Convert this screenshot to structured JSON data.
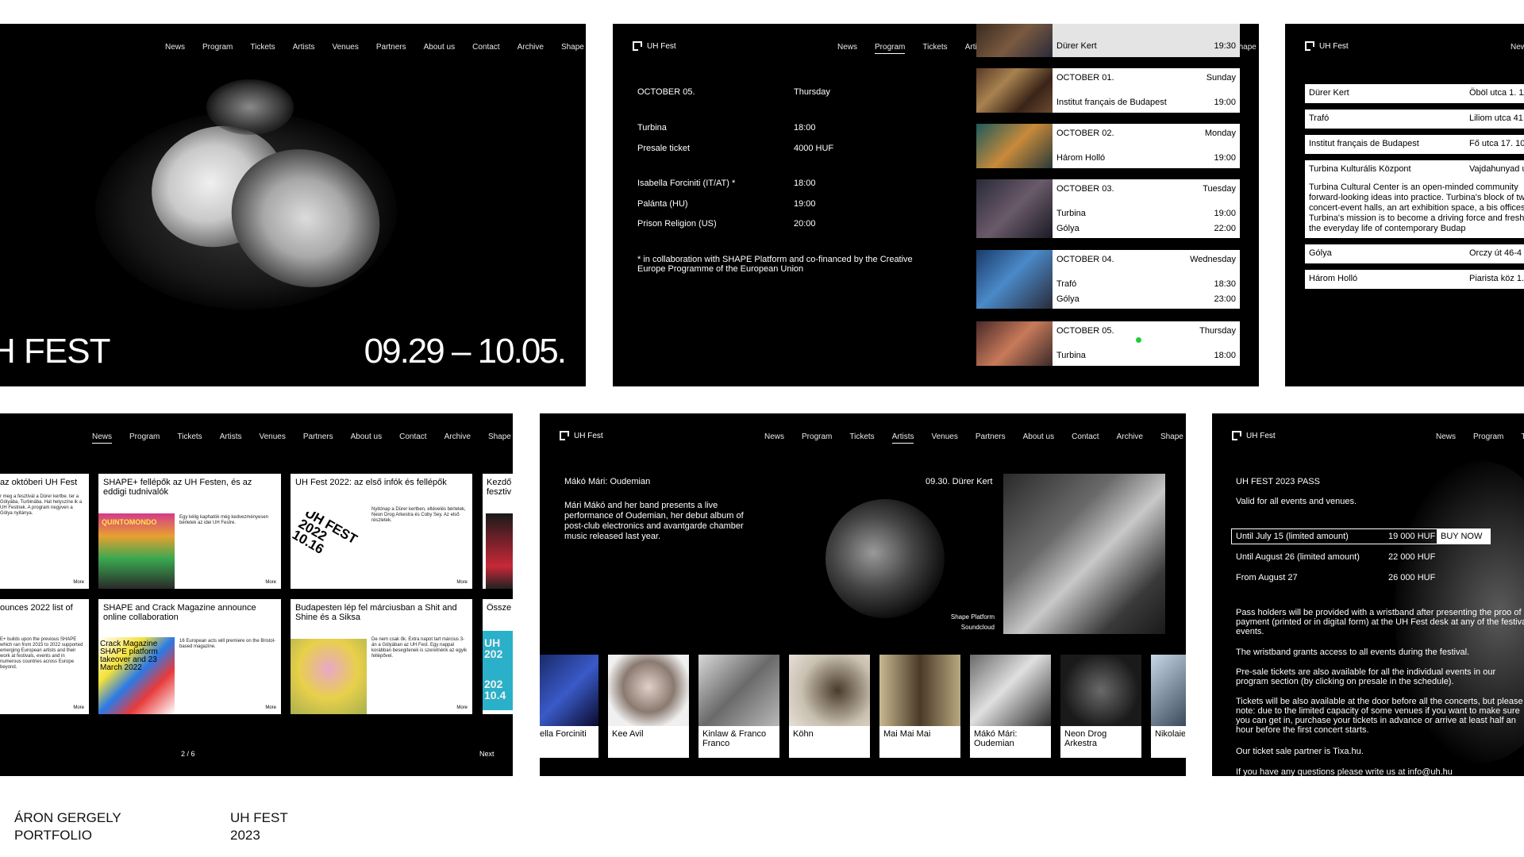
{
  "nav": [
    "News",
    "Program",
    "Tickets",
    "Artists",
    "Venues",
    "Partners",
    "About us",
    "Contact",
    "Archive",
    "Shape"
  ],
  "brand": "UH Fest",
  "hero": {
    "title": "H FEST",
    "dates": "09.29 – 10.05."
  },
  "program": {
    "date": "OCTOBER 05.",
    "weekday": "Thursday",
    "venue": "Turbina",
    "venue_time": "18:00",
    "presale_label": "Presale ticket",
    "presale_price": "4000 HUF",
    "acts": [
      {
        "name": "Isabella Forciniti (IT/AT) *",
        "time": "18:00"
      },
      {
        "name": "Palánta (HU)",
        "time": "19:00"
      },
      {
        "name": "Prison Religion (US)",
        "time": "20:00"
      }
    ],
    "note": "* in collaboration with SHAPE Platform and co-financed by the Creative Europe Programme of the European Union",
    "schedule": [
      {
        "date": "",
        "day": "",
        "rows": [
          {
            "venue": "Dürer Kert",
            "time": "19:30"
          }
        ]
      },
      {
        "date": "OCTOBER 01.",
        "day": "Sunday",
        "rows": [
          {
            "venue": "Institut français de Budapest",
            "time": "19:00"
          }
        ]
      },
      {
        "date": "OCTOBER 02.",
        "day": "Monday",
        "rows": [
          {
            "venue": "Három Holló",
            "time": "19:00"
          }
        ]
      },
      {
        "date": "OCTOBER 03.",
        "day": "Tuesday",
        "rows": [
          {
            "venue": "Turbina",
            "time": "19:00"
          },
          {
            "venue": "Gólya",
            "time": "22:00"
          }
        ]
      },
      {
        "date": "OCTOBER 04.",
        "day": "Wednesday",
        "rows": [
          {
            "venue": "Trafó",
            "time": "18:30"
          },
          {
            "venue": "Gólya",
            "time": "23:00"
          }
        ]
      },
      {
        "date": "OCTOBER 05.",
        "day": "Thursday",
        "rows": [
          {
            "venue": "Turbina",
            "time": "18:00"
          }
        ]
      }
    ]
  },
  "venues": {
    "list": [
      {
        "name": "Dürer Kert",
        "addr": "Öböl utca 1. 1117"
      },
      {
        "name": "Trafó",
        "addr": "Liliom utca 41."
      },
      {
        "name": "Institut français de Budapest",
        "addr": "Fő utca 17. 1011"
      },
      {
        "name": "Turbina Kulturális Központ",
        "addr": "Vajdahunyad u"
      },
      {
        "name": "Gólya",
        "addr": "Orczy út 46-4"
      },
      {
        "name": "Három Holló",
        "addr": "Piarista köz 1. 1"
      }
    ],
    "desc": "Turbina Cultural Center is an open-minded community forward-looking ideas into practice. Turbina's block of two concert-event halls, an art exhibition space, a bis offices. Turbina's mission is to become a driving force and freshen the everyday life of contemporary Budap"
  },
  "news": {
    "cards": [
      {
        "title": "az októberi UH Fest",
        "body": "r meg a fesztivál a Dürer kertbe. ter a Gólyába, Turbinába. Hat helyszíne ik a UH Festnek. A program negyven a Gólya nyitánya."
      },
      {
        "title": "SHAPE+ fellépők az UH Festen, és az eddigi tudnivalók",
        "body": "Egy kélig kaphatók még kedvezményesen bérletek az idei UH Festre."
      },
      {
        "title": "UH Fest 2022: az első infók és fellépők",
        "body": "Nyitónap a Dürer kertben, eltévelés bérletek, Neon Drog Arkestra és Coby Sey. Az első részletek."
      },
      {
        "title": "Kezdő fesztiv",
        "body": ""
      },
      {
        "title": "ounces 2022 list of",
        "body": "E+ builds upon the previous SHAPE which ran from 2015 to 2022 supported emerging European artists and their work at festivals, events and in numerous countries across Europe beyond."
      },
      {
        "title": "SHAPE and Crack Magazine announce online collaboration",
        "body": "16 European acts will premiere on the Bristol-based magazine."
      },
      {
        "title": "Budapesten lép fel márciusban a Shit and Shine és a Siksa",
        "body": "De nem csak ők. Extra napot tart március 3-án a Gólyában az UH Fest. Egy nappal korábban besegítenek is szeretnénk az egyik fellépővel."
      },
      {
        "title": "Össze",
        "body": ""
      }
    ],
    "more": "More",
    "pager": "2 / 6",
    "next": "Next",
    "img_texts": [
      "QUINTOMONDO",
      "UH FEST 2022 10.16",
      "Crack Magazine SHAPE platform takeover and 23 March 2022",
      "UH 202",
      "202 10.4"
    ]
  },
  "artists": {
    "name": "Mákó Mári: Oudemian",
    "date_venue": "09.30. Dürer Kert",
    "bio": "Mári Mákó and her band presents a live performance of Oudemian, her debut album of post-club electronics and avantgarde chamber music released last year.",
    "links": [
      "Shape Platform",
      "Soundcloud"
    ],
    "strip": [
      "ella Forciniti",
      "Kee Avil",
      "Kinlaw & Franco Franco",
      "Köhn",
      "Mai Mai Mai",
      "Mákó Mári: Oudemian",
      "Neon Drog Arkestra",
      "Nikolaie"
    ]
  },
  "tickets": {
    "title": "UH FEST 2023 PASS",
    "sub": "Valid for all events and venues.",
    "tiers": [
      {
        "label": "Until July 15 (limited amount)",
        "price": "19 000 HUF",
        "btn": "BUY NOW"
      },
      {
        "label": "Until August 26 (limited amount)",
        "price": "22 000 HUF"
      },
      {
        "label": "From August 27",
        "price": "26 000 HUF"
      }
    ],
    "paras": [
      "Pass holders will be provided with a wristband after presenting the proo of payment (printed or in digital form) at the UH Fest desk at any of the festival events.",
      "The wristband grants access to all events during the festival.",
      "Pre-sale tickets are also available for all the individual events in our program section (by clicking on presale in the schedule).",
      "Tickets will be also available at the door before all the concerts, but please note: due to the limited capacity of some venues if you want to make sure you can get in, purchase your tickets in advance or arrive at least half an hour before the first concert starts.",
      "Our ticket sale partner is Tixa.hu.",
      "If you have any questions please write us at info@uh.hu"
    ]
  },
  "footer": {
    "author_1": "ÁRON GERGELY",
    "author_2": "PORTFOLIO",
    "project_1": "UH FEST",
    "project_2": "2023"
  },
  "colors": {
    "panel": "#000000",
    "page": "#ffffff",
    "accent_dot": "#22cc33"
  }
}
